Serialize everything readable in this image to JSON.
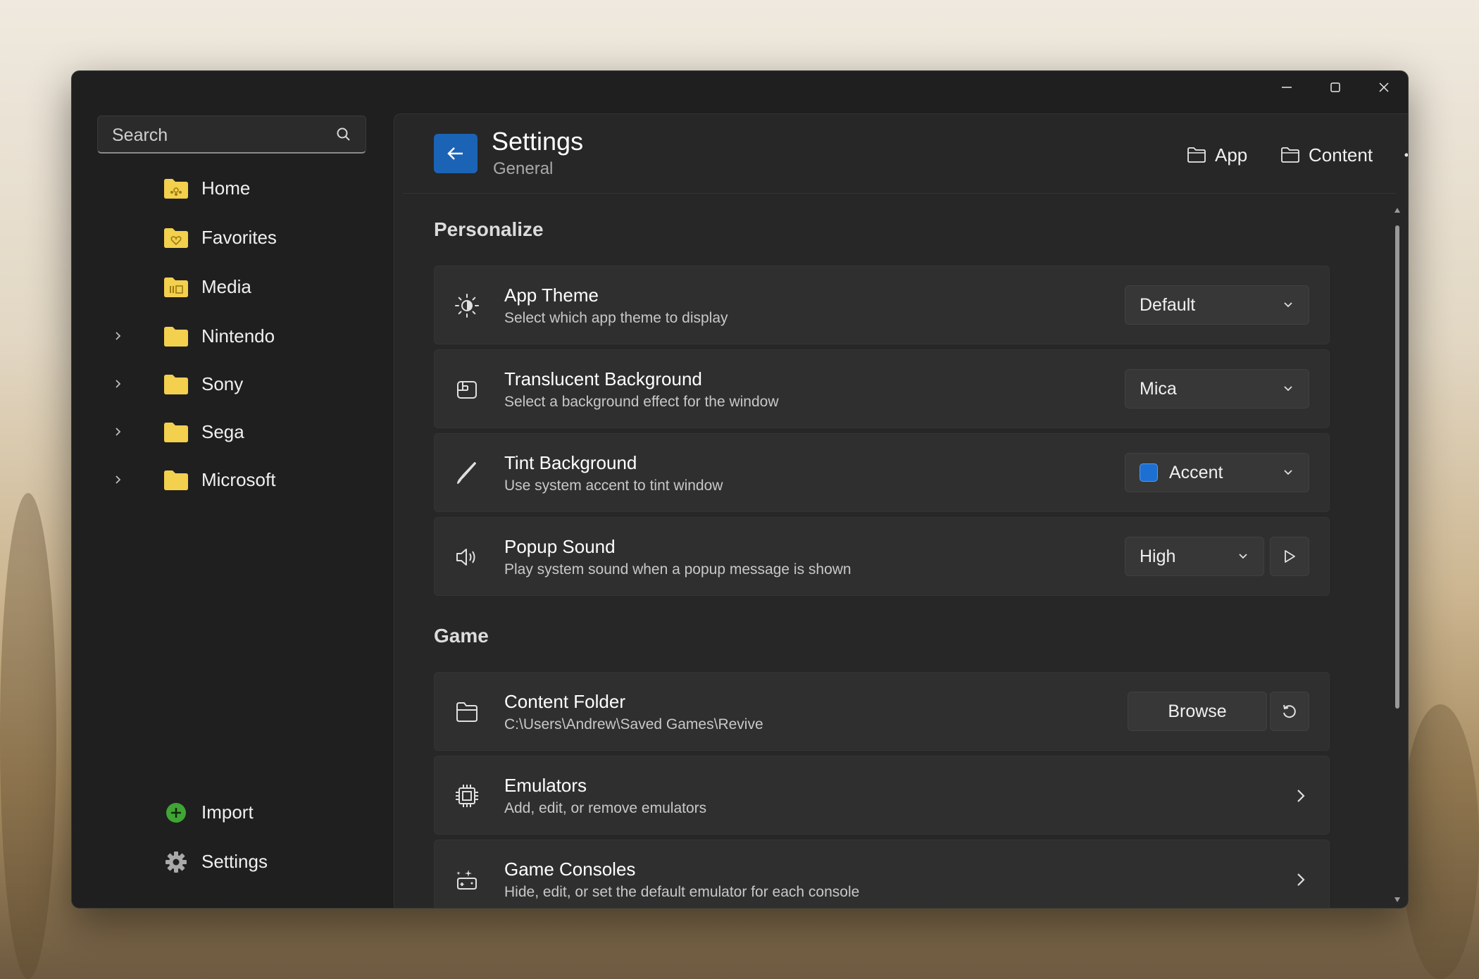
{
  "window_controls": {
    "minimize": "minimize-icon",
    "maximize": "maximize-icon",
    "close": "close-icon"
  },
  "sidebar": {
    "search": {
      "placeholder": "Search"
    },
    "items": [
      {
        "label": "Home",
        "icon": "folder-home-icon",
        "expandable": false
      },
      {
        "label": "Favorites",
        "icon": "folder-heart-icon",
        "expandable": false
      },
      {
        "label": "Media",
        "icon": "folder-media-icon",
        "expandable": false
      },
      {
        "label": "Nintendo",
        "icon": "folder-icon",
        "expandable": true
      },
      {
        "label": "Sony",
        "icon": "folder-icon",
        "expandable": true
      },
      {
        "label": "Sega",
        "icon": "folder-icon",
        "expandable": true
      },
      {
        "label": "Microsoft",
        "icon": "folder-icon",
        "expandable": true
      }
    ],
    "footer": [
      {
        "label": "Import",
        "icon": "add-circle-icon"
      },
      {
        "label": "Settings",
        "icon": "gear-icon"
      }
    ]
  },
  "header": {
    "title": "Settings",
    "subtitle": "General",
    "app_label": "App",
    "content_label": "Content",
    "more": "more-icon"
  },
  "sections": {
    "personalize": "Personalize",
    "game": "Game"
  },
  "settings": {
    "app_theme": {
      "title": "App Theme",
      "desc": "Select which app theme to display",
      "value": "Default"
    },
    "translucent": {
      "title": "Translucent Background",
      "desc": "Select a background effect for the window",
      "value": "Mica"
    },
    "tint": {
      "title": "Tint Background",
      "desc": "Use system accent to tint window",
      "value": "Accent",
      "swatch_color": "#1d6fd1"
    },
    "popup_sound": {
      "title": "Popup Sound",
      "desc": "Play system sound when a popup message is shown",
      "value": "High"
    },
    "content_folder": {
      "title": "Content Folder",
      "desc": "C:\\Users\\Andrew\\Saved Games\\Revive",
      "browse_label": "Browse"
    },
    "emulators": {
      "title": "Emulators",
      "desc": "Add, edit, or remove emulators"
    },
    "game_consoles": {
      "title": "Game Consoles",
      "desc": "Hide, edit, or set the default emulator for each console"
    }
  },
  "colors": {
    "accent": "#1b63b5",
    "folder": "#f3d04d",
    "import_green": "#3fa535"
  }
}
